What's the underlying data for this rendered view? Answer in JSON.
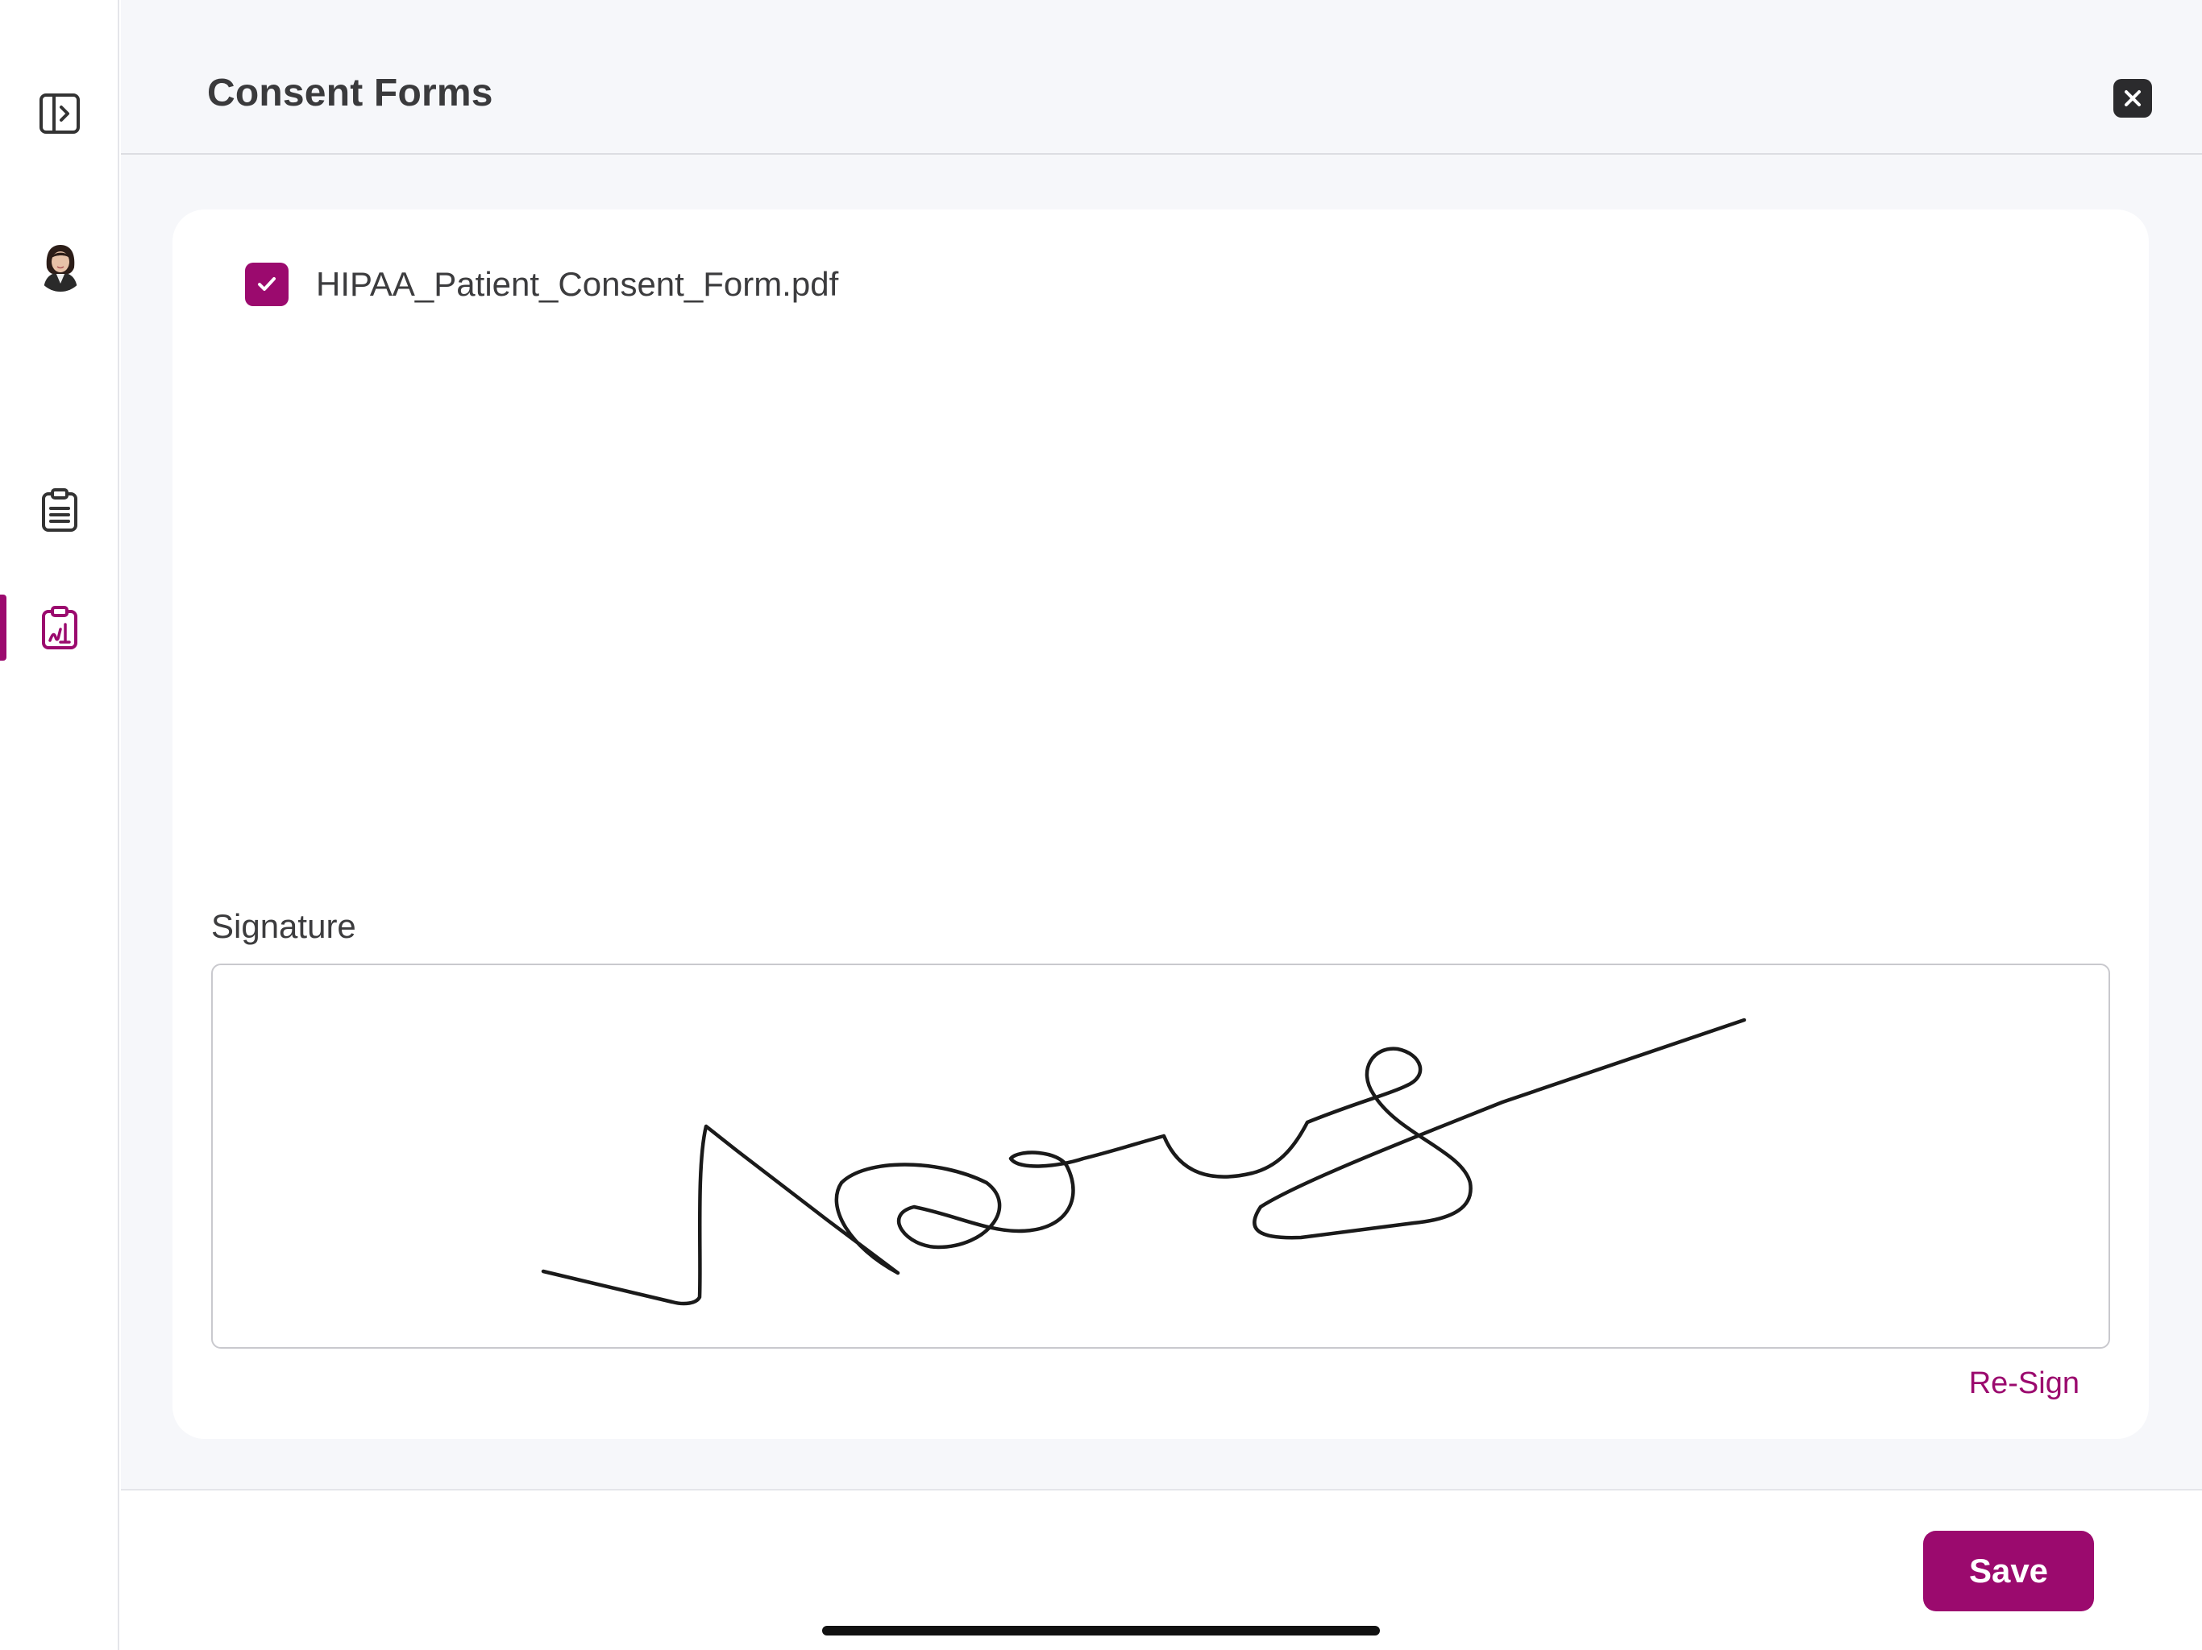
{
  "app": {
    "accent_color": "#9b0a6e"
  },
  "sidebar": {
    "items": [
      {
        "name": "sidebar-expand",
        "icon": "sidebar-toggle-icon"
      },
      {
        "name": "user-avatar",
        "icon": "avatar"
      },
      {
        "name": "notes",
        "icon": "clipboard-list-icon"
      },
      {
        "name": "consent-forms",
        "icon": "clipboard-signature-icon",
        "active": true
      }
    ]
  },
  "header": {
    "title": "Consent Forms",
    "close_icon": "close-icon"
  },
  "document": {
    "checked": true,
    "file_name": "HIPAA_Patient_Consent_Form.pdf"
  },
  "signature": {
    "label": "Signature",
    "resign_label": "Re-Sign"
  },
  "footer": {
    "save_label": "Save"
  }
}
